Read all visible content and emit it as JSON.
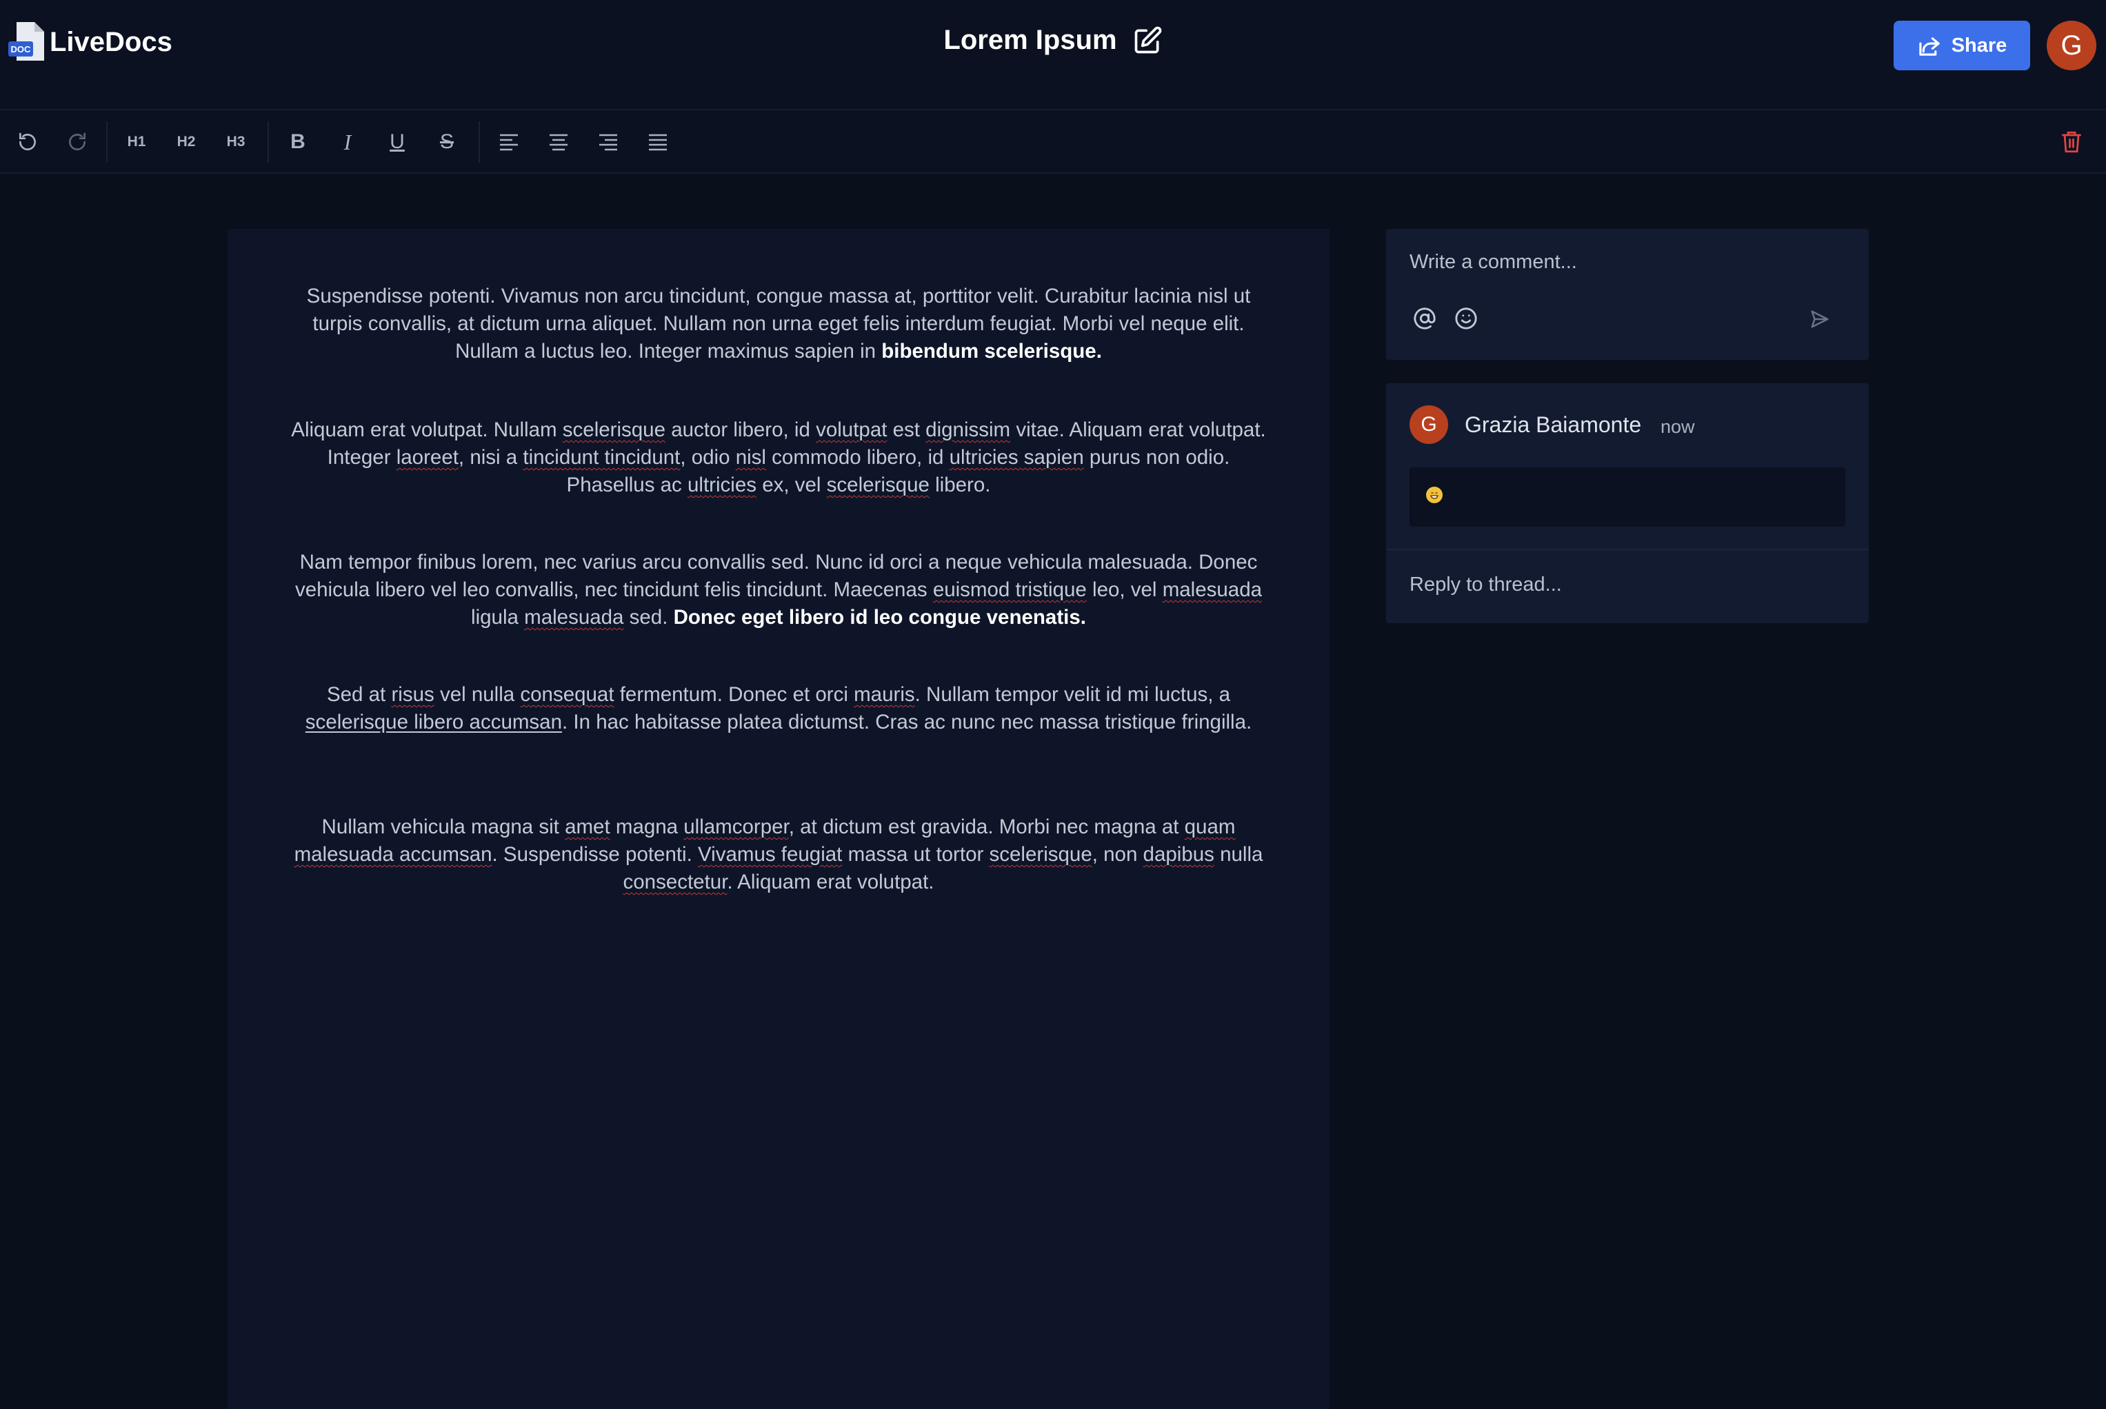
{
  "app": {
    "name": "LiveDocs",
    "logo_badge": "DOC"
  },
  "document": {
    "title": "Lorem Ipsum"
  },
  "header": {
    "share_label": "Share",
    "avatar_initial": "G"
  },
  "toolbar": {
    "h1": "H1",
    "h2": "H2",
    "h3": "H3",
    "bold": "B",
    "italic": "I",
    "underline": "U",
    "strike": "S"
  },
  "paragraphs": [
    [
      "Suspendisse potenti. Vivamus non arcu tincidunt, congue massa at, porttitor velit. Curabitur lacinia nisl ut turpis convallis, at dictum urna aliquet. Nullam non urna eget felis interdum feugiat. Morbi vel neque elit. Nullam a luctus leo. Integer maximus sapien in ",
      "bibendum scelerisque."
    ],
    [
      "Aliquam erat volutpat. Nullam ",
      "scelerisque",
      " auctor libero, id ",
      "volutpat",
      " est ",
      "dignissim",
      " vitae. Aliquam erat volutpat. Integer ",
      "laoreet",
      ", nisi a ",
      "tincidunt tincidunt",
      ", odio ",
      "nisl",
      " commodo libero, id ",
      "ultricies sapien",
      " purus non odio. Phasellus ac ",
      "ultricies",
      " ex, vel ",
      "scelerisque",
      " libero."
    ],
    [
      "Nam tempor finibus lorem, nec varius arcu convallis sed. Nunc id orci a neque vehicula malesuada. Donec vehicula libero vel leo convallis, nec tincidunt felis tincidunt. Maecenas ",
      "euismod tristique",
      " leo, vel ",
      "malesuada",
      " ligula ",
      "malesuada",
      " sed. ",
      "Donec eget libero id leo congue venenatis."
    ],
    [
      "Sed at ",
      "risus",
      " vel nulla ",
      "consequat",
      " fermentum. Donec et orci ",
      "mauris",
      ". Nullam tempor velit id mi luctus, a ",
      "scelerisque libero accumsan",
      ". In hac habitasse platea dictumst. Cras ac nunc nec massa tristique fringilla."
    ],
    [
      "Nullam vehicula magna sit ",
      "amet",
      " magna ",
      "ullamcorper",
      ", at dictum est gravida. Morbi nec magna at ",
      "quam malesuada accumsan",
      ". Suspendisse potenti. ",
      "Vivamus feugiat",
      " massa ut tortor ",
      "scelerisque",
      ", non ",
      "dapibus",
      " nulla ",
      "consectetur",
      ". Aliquam erat volutpat."
    ]
  ],
  "comments": {
    "input_placeholder": "Write a comment...",
    "thread": {
      "author": "Grazia Baiamonte",
      "author_initial": "G",
      "time": "now",
      "reply_placeholder": "Reply to thread..."
    }
  },
  "colors": {
    "accent": "#3c6fea",
    "avatar": "#b8401f",
    "delete": "#e04545",
    "background": "#0a0f1c"
  }
}
